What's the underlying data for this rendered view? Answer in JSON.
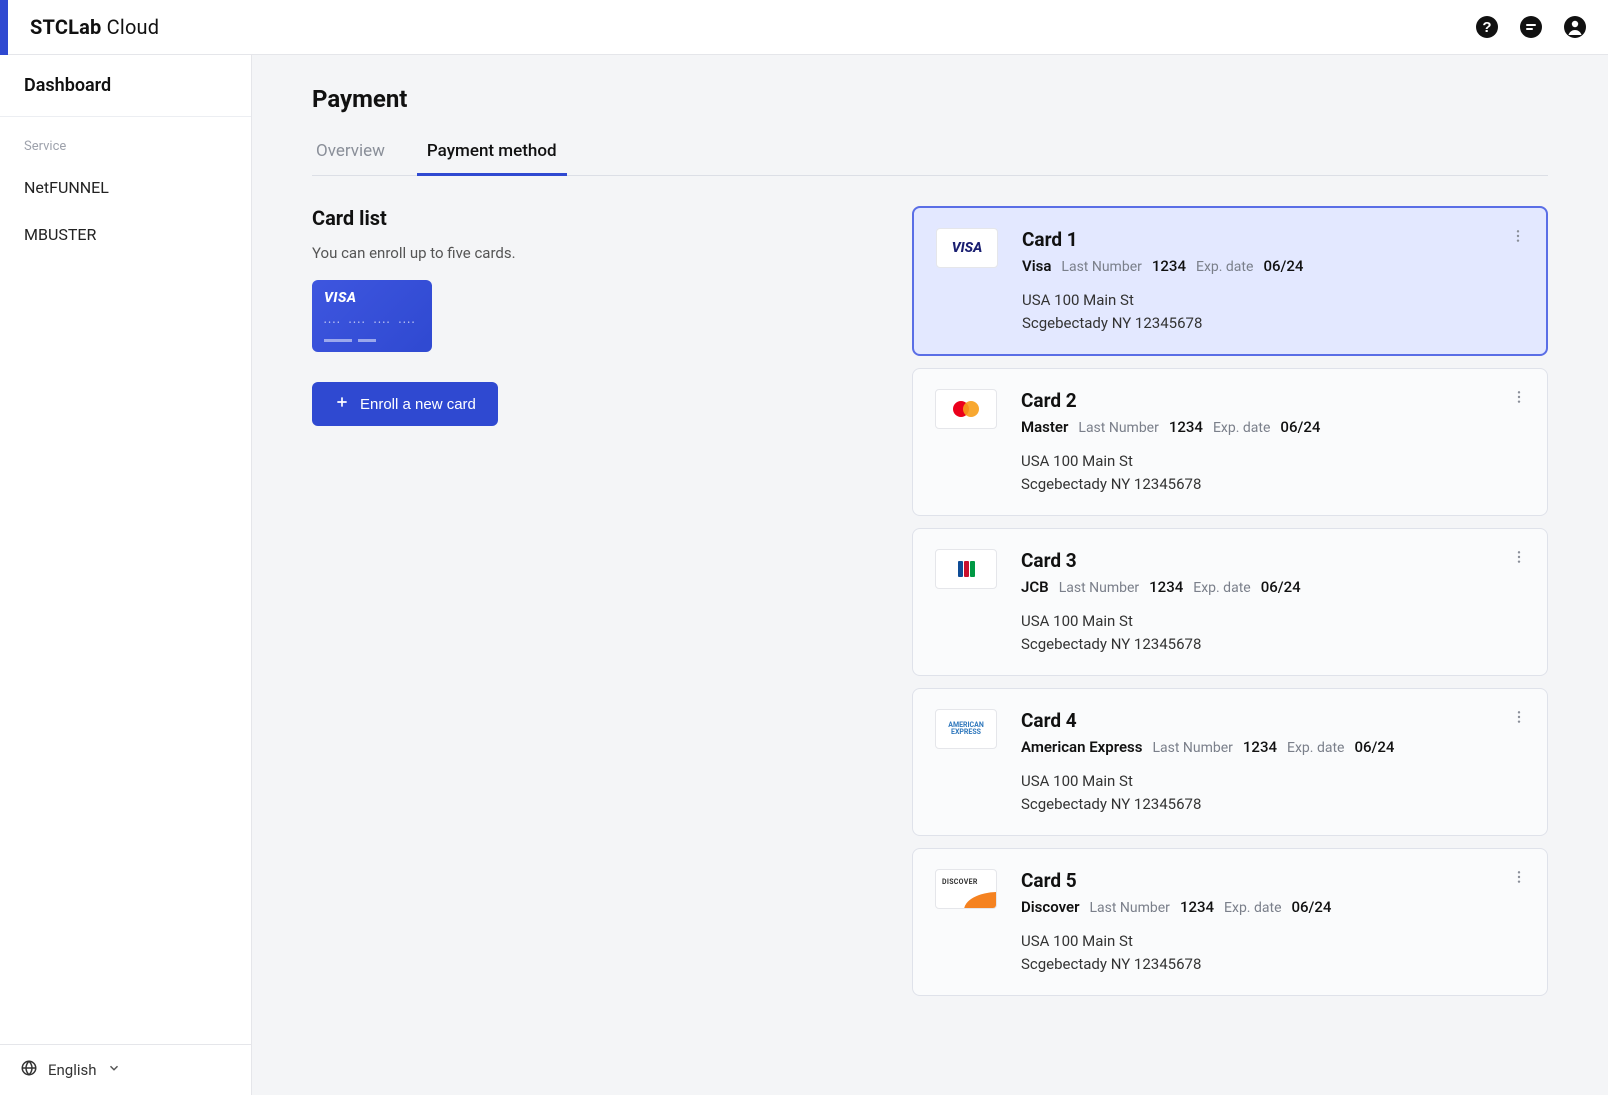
{
  "brand": {
    "strong": "STCLab",
    "light": "Cloud"
  },
  "sidebar": {
    "dashboard_label": "Dashboard",
    "section_label": "Service",
    "items": [
      {
        "label": "NetFUNNEL"
      },
      {
        "label": "MBUSTER"
      }
    ],
    "language": "English"
  },
  "page": {
    "title": "Payment",
    "tabs": [
      {
        "label": "Overview",
        "active": false
      },
      {
        "label": "Payment method",
        "active": true
      }
    ]
  },
  "card_list": {
    "title": "Card list",
    "subtitle": "You can enroll up to five cards.",
    "enroll_label": "Enroll a new card"
  },
  "labels": {
    "last_number": "Last Number",
    "exp_date": "Exp. date"
  },
  "cards": [
    {
      "name": "Card 1",
      "brand": "Visa",
      "brand_key": "visa",
      "last4": "1234",
      "exp": "06/24",
      "addr1": "USA 100 Main St",
      "addr2": "Scgebectady NY 12345678",
      "selected": true
    },
    {
      "name": "Card 2",
      "brand": "Master",
      "brand_key": "master",
      "last4": "1234",
      "exp": "06/24",
      "addr1": "USA 100 Main St",
      "addr2": "Scgebectady NY 12345678",
      "selected": false
    },
    {
      "name": "Card 3",
      "brand": "JCB",
      "brand_key": "jcb",
      "last4": "1234",
      "exp": "06/24",
      "addr1": "USA 100 Main St",
      "addr2": "Scgebectady NY 12345678",
      "selected": false
    },
    {
      "name": "Card 4",
      "brand": "American Express",
      "brand_key": "amex",
      "last4": "1234",
      "exp": "06/24",
      "addr1": "USA 100 Main St",
      "addr2": "Scgebectady NY 12345678",
      "selected": false
    },
    {
      "name": "Card 5",
      "brand": "Discover",
      "brand_key": "discover",
      "last4": "1234",
      "exp": "06/24",
      "addr1": "USA 100 Main St",
      "addr2": "Scgebectady NY 12345678",
      "selected": false
    }
  ]
}
